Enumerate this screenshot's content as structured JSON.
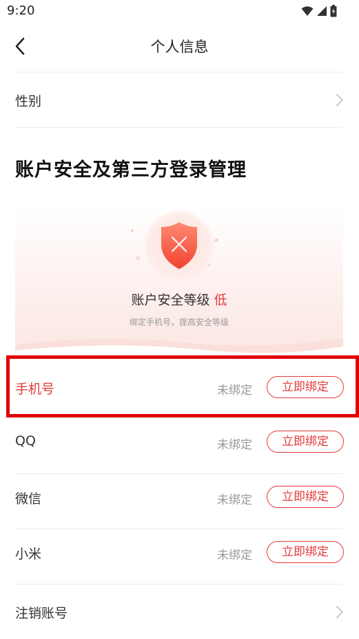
{
  "status_bar": {
    "time": "9:20",
    "icons": [
      "wifi-icon",
      "signal-icon",
      "battery-icon"
    ]
  },
  "nav": {
    "title": "个人信息",
    "back_icon": "chevron-left-icon"
  },
  "gender_row": {
    "label": "性别"
  },
  "section": {
    "heading": "账户安全及第三方登录管理"
  },
  "security": {
    "label": "账户安全等级",
    "level": "低",
    "hint": "绑定手机号，提高安全等级",
    "icon": "shield-x-icon"
  },
  "bindings": [
    {
      "label": "手机号",
      "status": "未绑定",
      "action": "立即绑定"
    },
    {
      "label": "QQ",
      "status": "未绑定",
      "action": "立即绑定"
    },
    {
      "label": "微信",
      "status": "未绑定",
      "action": "立即绑定"
    },
    {
      "label": "小米",
      "status": "未绑定",
      "action": "立即绑定"
    }
  ],
  "cancel_row": {
    "label": "注销账号"
  },
  "colors": {
    "accent": "#e33a3a",
    "highlight": "#e00000",
    "muted": "#999999"
  }
}
